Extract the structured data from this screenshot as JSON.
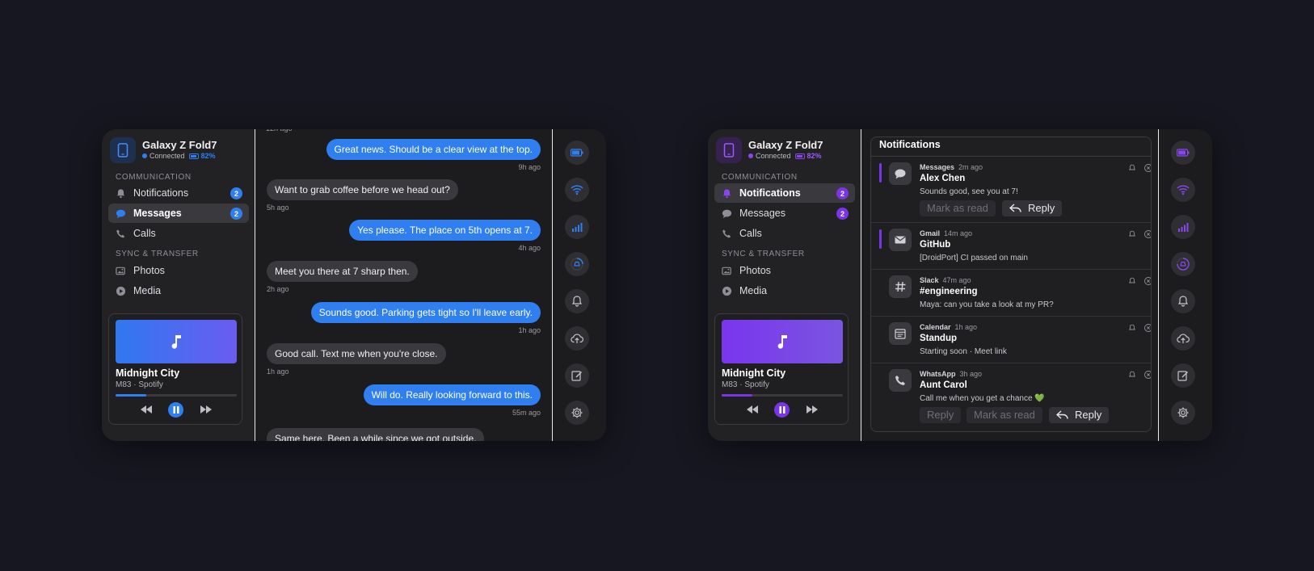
{
  "colors": {
    "page_bg": "#161720",
    "left_accent": "#2f7ff0",
    "right_accent": "#7b35e8",
    "art_left_from": "#3078f0",
    "art_left_to": "#6a5cf0",
    "art_right_from": "#7a35ee",
    "art_right_to": "#7a55e0",
    "whatsapp_heart": "#3ecf6b"
  },
  "left": {
    "device": {
      "name": "Galaxy Z Fold7",
      "status": "Connected",
      "battery": "82%",
      "icon": "phone-icon"
    },
    "sections": {
      "communication": "COMMUNICATION",
      "sync": "SYNC & TRANSFER"
    },
    "nav": [
      {
        "label": "Notifications",
        "icon": "bell-icon",
        "badge": "2"
      },
      {
        "label": "Messages",
        "icon": "chat-bubble-icon",
        "badge": "2",
        "active": true
      },
      {
        "label": "Calls",
        "icon": "phone-call-icon"
      },
      {
        "label": "Photos",
        "icon": "photos-icon"
      },
      {
        "label": "Media",
        "icon": "play-circle-icon"
      }
    ],
    "player": {
      "title": "Midnight City",
      "artist": "M83 · Spotify",
      "progress": 0.25
    },
    "chat": [
      {
        "text": "Great news. Should be a clear view at the top.",
        "dir": "out",
        "time": "9h ago"
      },
      {
        "text": "Want to grab coffee before we head out?",
        "dir": "in",
        "time": "5h ago"
      },
      {
        "text": "Yes please. The place on 5th opens at 7.",
        "dir": "out",
        "time": "4h ago"
      },
      {
        "text": "Meet you there at 7 sharp then.",
        "dir": "in",
        "time": "2h ago"
      },
      {
        "text": "Sounds good. Parking gets tight so I'll leave early.",
        "dir": "out",
        "time": "1h ago"
      },
      {
        "text": "Good call. Text me when you're close.",
        "dir": "in",
        "time": "1h ago"
      },
      {
        "text": "Will do. Really looking forward to this.",
        "dir": "out",
        "time": "55m ago"
      },
      {
        "text": "Same here. Been a while since we got outside.",
        "dir": "in",
        "time": ""
      }
    ]
  },
  "right": {
    "device": {
      "name": "Galaxy Z Fold7",
      "status": "Connected",
      "battery": "82%",
      "icon": "phone-icon"
    },
    "sections": {
      "communication": "COMMUNICATION",
      "sync": "SYNC & TRANSFER"
    },
    "nav": [
      {
        "label": "Notifications",
        "icon": "bell-icon",
        "badge": "2",
        "active": true
      },
      {
        "label": "Messages",
        "icon": "chat-bubble-icon",
        "badge": "2"
      },
      {
        "label": "Calls",
        "icon": "phone-call-icon"
      },
      {
        "label": "Photos",
        "icon": "photos-icon"
      },
      {
        "label": "Media",
        "icon": "play-circle-icon"
      }
    ],
    "player": {
      "title": "Midnight City",
      "artist": "M83 · Spotify",
      "progress": 0.25
    },
    "panel_title": "Notifications",
    "notifications": [
      {
        "app": "Messages",
        "time": "2m ago",
        "title": "Alex Chen",
        "body": "Sounds good, see you at 7!",
        "icon": "chat-bubble-icon",
        "unread": true,
        "actions": [
          "Mark as read",
          "Reply"
        ]
      },
      {
        "app": "Gmail",
        "time": "14m ago",
        "title": "GitHub",
        "body": "[DroidPort] CI passed on main",
        "icon": "mail-icon",
        "unread": true,
        "actions": []
      },
      {
        "app": "Slack",
        "time": "47m ago",
        "title": "#engineering",
        "body": "Maya: can you take a look at my PR?",
        "icon": "hash-icon",
        "unread": false,
        "actions": []
      },
      {
        "app": "Calendar",
        "time": "1h ago",
        "title": "Standup",
        "body": "Starting soon · Meet link",
        "icon": "calendar-icon",
        "unread": false,
        "actions": []
      },
      {
        "app": "WhatsApp",
        "time": "3h ago",
        "title": "Aunt Carol",
        "body": "Call me when you get a chance 💚",
        "icon": "phone-call-icon",
        "unread": false,
        "actions": [
          "Reply",
          "Mark as read",
          "Reply"
        ]
      }
    ]
  },
  "rightbar_icons": [
    "battery-icon",
    "wifi-icon",
    "signal-icon",
    "sync-progress-icon",
    "bell-icon",
    "cloud-upload-icon",
    "edit-icon",
    "gear-icon"
  ]
}
